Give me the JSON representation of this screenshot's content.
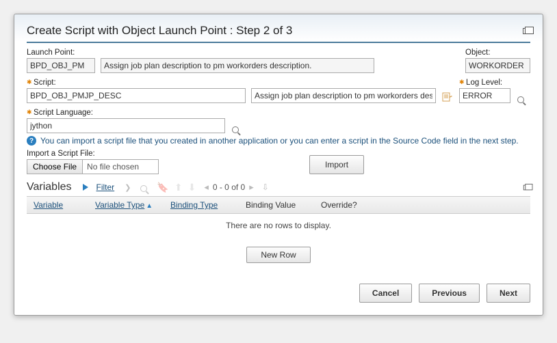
{
  "dialog": {
    "title": "Create Script with Object Launch Point : Step 2 of 3"
  },
  "launchPoint": {
    "label": "Launch Point:",
    "value": "BPD_OBJ_PM",
    "desc": "Assign job plan description to pm workorders description."
  },
  "object": {
    "label": "Object:",
    "value": "WORKORDER"
  },
  "script": {
    "label": "Script:",
    "value": "BPD_OBJ_PMJP_DESC",
    "desc": "Assign job plan description to pm workorders description."
  },
  "logLevel": {
    "label": "Log Level:",
    "value": "ERROR"
  },
  "scriptLang": {
    "label": "Script Language:",
    "value": "jython"
  },
  "info": "You can import a script file that you created in another application or you can enter a script in the Source Code field in the next step.",
  "importFile": {
    "label": "Import a Script File:",
    "chooseBtn": "Choose File",
    "noFile": "No file chosen",
    "importBtn": "Import"
  },
  "variables": {
    "title": "Variables",
    "filter": "Filter",
    "pager": "0 - 0 of 0",
    "cols": {
      "variable": "Variable",
      "variableType": "Variable Type",
      "bindingType": "Binding Type",
      "bindingValue": "Binding Value",
      "override": "Override?"
    },
    "empty": "There are no rows to display.",
    "newRow": "New Row"
  },
  "buttons": {
    "cancel": "Cancel",
    "previous": "Previous",
    "next": "Next"
  }
}
